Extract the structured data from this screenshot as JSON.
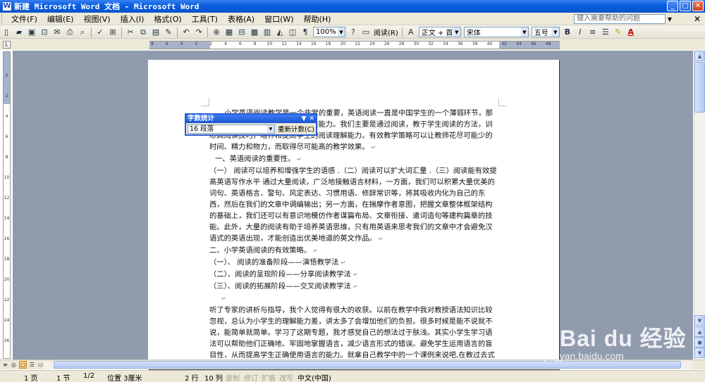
{
  "window": {
    "title": "新建 Microsoft Word 文档 - Microsoft Word",
    "controls": [
      "_",
      "□",
      "✕"
    ]
  },
  "menubar": {
    "items": [
      "文件(F)",
      "编辑(E)",
      "视图(V)",
      "插入(I)",
      "格式(O)",
      "工具(T)",
      "表格(A)",
      "窗口(W)",
      "帮助(H)"
    ],
    "help_placeholder": "键入需要帮助的问题",
    "close_doc": "✕"
  },
  "toolbar": {
    "zoom": "100%",
    "read_label": "阅读(R)",
    "style": "正文 + 首行",
    "font": "宋体",
    "size": "五号",
    "bold": "B",
    "italic": "I",
    "font_color": "A"
  },
  "ruler": {
    "corner": "L",
    "h_numbers": [
      "8",
      "6",
      "4",
      "2",
      "2",
      "4",
      "6",
      "8",
      "10",
      "12",
      "14",
      "16",
      "18",
      "20",
      "22",
      "24",
      "26",
      "28",
      "30",
      "32",
      "34",
      "36",
      "38",
      "40",
      "42",
      "44",
      "46",
      "48"
    ],
    "v_numbers": [
      "2",
      "2",
      "4",
      "6",
      "8",
      "10",
      "12",
      "14",
      "16",
      "18",
      "20",
      "22",
      "24",
      "26"
    ]
  },
  "word_count_panel": {
    "title": "字数统计",
    "selection": "16 段落",
    "recount_label": "重新计数(C)"
  },
  "document": {
    "paragraphs": [
      "小学英语阅读教学是一个非常的重要，英语阅读一直是中国学生的一个薄弱环节，那么如何才能更好的提高学生的阅读能力。我们主要是通过阅读，教于学生阅读的方法，训练其阅读技巧，培养和提高学生的阅读理解能力。有效教学策略可以让教师花尽可能少的时间、精力和物力，而取得尽可能高的教学效果。",
      "一、英语阅读的重要性。",
      "（一） 阅读可以培养和增强学生的语感 .（二）阅读可以扩大词汇量 .（三）阅读能有效提高英语写作水平 通过大量阅读，广泛地接触语言材料，一方面，我们可以积累大量优美的词句、英语格言、警句、风定表达、习惯用语、修辞常识等，将其吸收内化为自己的东西，然后在我们的文章中调编输出；另一方面，在揣摩作者意图，把握文章整体框架结构的基础上，我们还可以有意识地模仿作者谋篇布局、文章衔接、遣词造句等建构篇章的技能。此外，大量的阅读有助于培养英语思维，只有用英语来思考我们的文章中才会避免汉语式的英语出现，才能创造出优美地道的英文作品。",
      "二、小学英语阅读的有效策略。",
      "（一）、 阅读的准备阶段——演悟教学法",
      "（二）、阅读的呈现阶段——分享阅读教学法",
      "（三）、阅读的拓展阶段——交叉阅读教学法",
      "",
      "听了专家的讲析与指导，我个人觉得有很大的收获。以前在教学中我对教授语法知识比较忽视，总认为小学生的理解能力差，讲太多了会增加他们的负担。很多时候是能不说就不说，能简单就简单。学习了这期专题，我才感觉自己的想法过于肤浅。其实小学生学习语法可以帮助他们正确地、牢固地掌握语言，减少语言形式的错误。避免学生运用语言的盲目性，从而提高学生正确使用语言的能力。就拿自己教学中的一个课例来说吧,在教过去式时，为了让学生对过去式有个基本的理解 ，我首先对过去式的变化规则作了说明：规则动词加 d或ed，不规则动词需要记。然后出示大量的练习题让学生进行巩固。但一段时间过后，只有基"
    ],
    "para_mark": "↵"
  },
  "statusbar": {
    "page": "1 页",
    "section": "1 节",
    "page_of": "1/2",
    "position": "位置 3厘米",
    "line": "2 行",
    "column": "10 列",
    "rec": "录制",
    "trk": "修订",
    "ext": "扩展",
    "ovr": "改写",
    "language": "中文(中国)"
  },
  "watermark": {
    "brand": "Bai du 经验",
    "url": "jingyan.baidu.com"
  },
  "colors": {
    "titlebar": "#0a5fe0",
    "workspace": "#919bae",
    "chrome": "#ece9d8"
  }
}
